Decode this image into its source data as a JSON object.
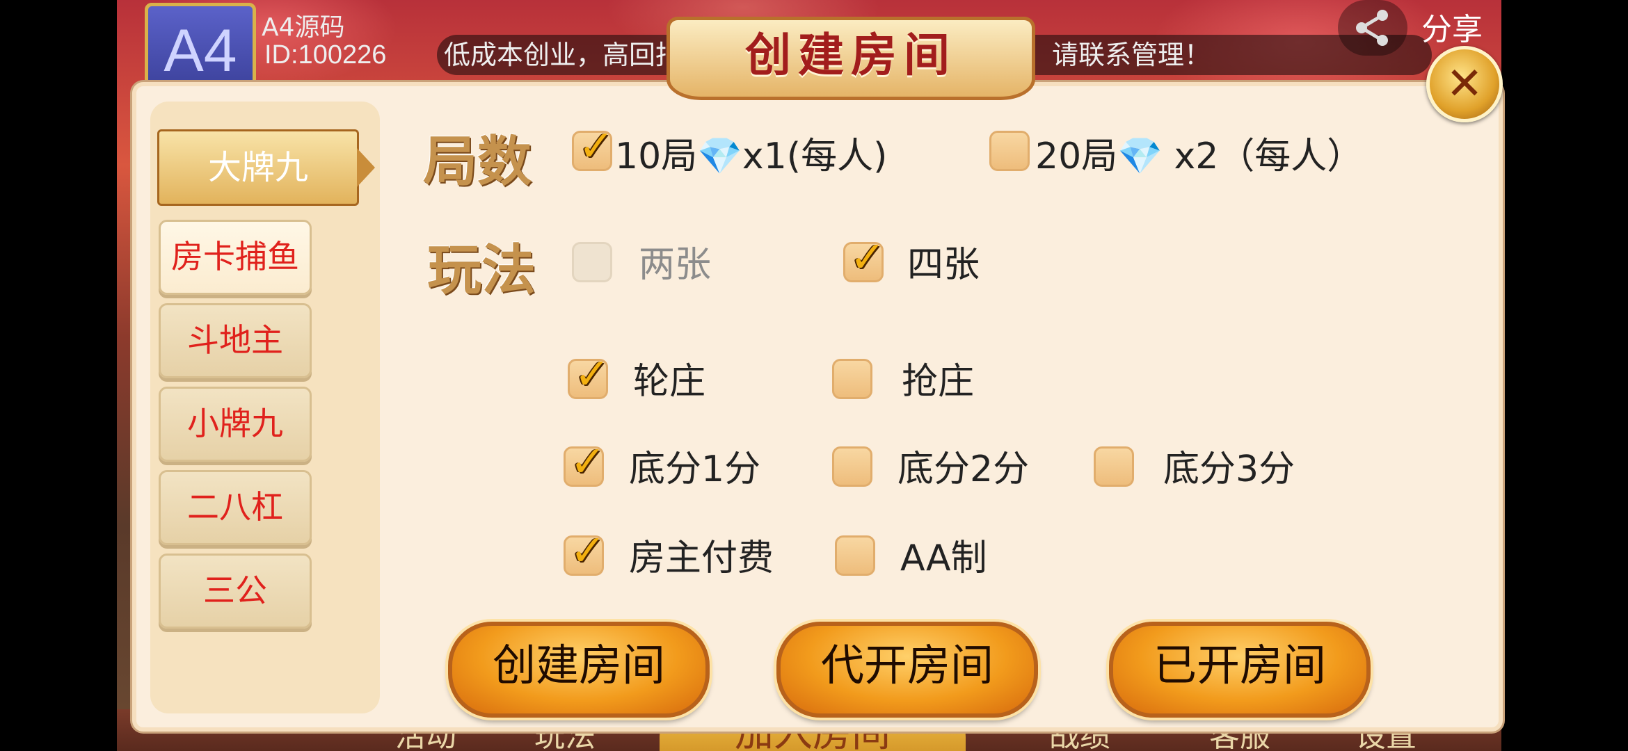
{
  "background": {
    "avatar_text": "A4",
    "username": "A4源码",
    "user_id": "ID:100226",
    "marquee": "低成本创业，高回报，可定制游戏开发，快速搭建，请联系管理！",
    "share_label": "分享",
    "bottom_items": [
      "活动",
      "玩法",
      "战绩",
      "客服",
      "设置"
    ],
    "join_room": "加入房间"
  },
  "dialog": {
    "title": "创建房间",
    "close_icon": "close-icon"
  },
  "sidebar": {
    "items": [
      {
        "label": "大牌九",
        "selected": true
      },
      {
        "label": "房卡捕鱼"
      },
      {
        "label": "斗地主"
      },
      {
        "label": "小牌九"
      },
      {
        "label": "二八杠"
      },
      {
        "label": "三公"
      }
    ]
  },
  "options": {
    "rounds_label": "局数",
    "rounds": [
      {
        "prefix": "10局",
        "gem": "💎",
        "suffix": "x1(每人)",
        "checked": true
      },
      {
        "prefix": "20局",
        "gem": "💎",
        "suffix": " x2（每人）",
        "checked": false
      }
    ],
    "play_label": "玩法",
    "cards": [
      {
        "label": "两张",
        "checked": false,
        "disabled": true
      },
      {
        "label": "四张",
        "checked": true
      }
    ],
    "banker": [
      {
        "label": "轮庄",
        "checked": true
      },
      {
        "label": "抢庄",
        "checked": false
      }
    ],
    "base_score": [
      {
        "label": "底分1分",
        "checked": true
      },
      {
        "label": "底分2分",
        "checked": false
      },
      {
        "label": "底分3分",
        "checked": false
      }
    ],
    "payment": [
      {
        "label": "房主付费",
        "checked": true
      },
      {
        "label": "AA制",
        "checked": false
      }
    ]
  },
  "actions": {
    "create": "创建房间",
    "proxy": "代开房间",
    "opened": "已开房间"
  },
  "colors": {
    "accent": "#f29b1c",
    "tab_text": "#e0211c",
    "panel_bg": "#fbeedd"
  }
}
